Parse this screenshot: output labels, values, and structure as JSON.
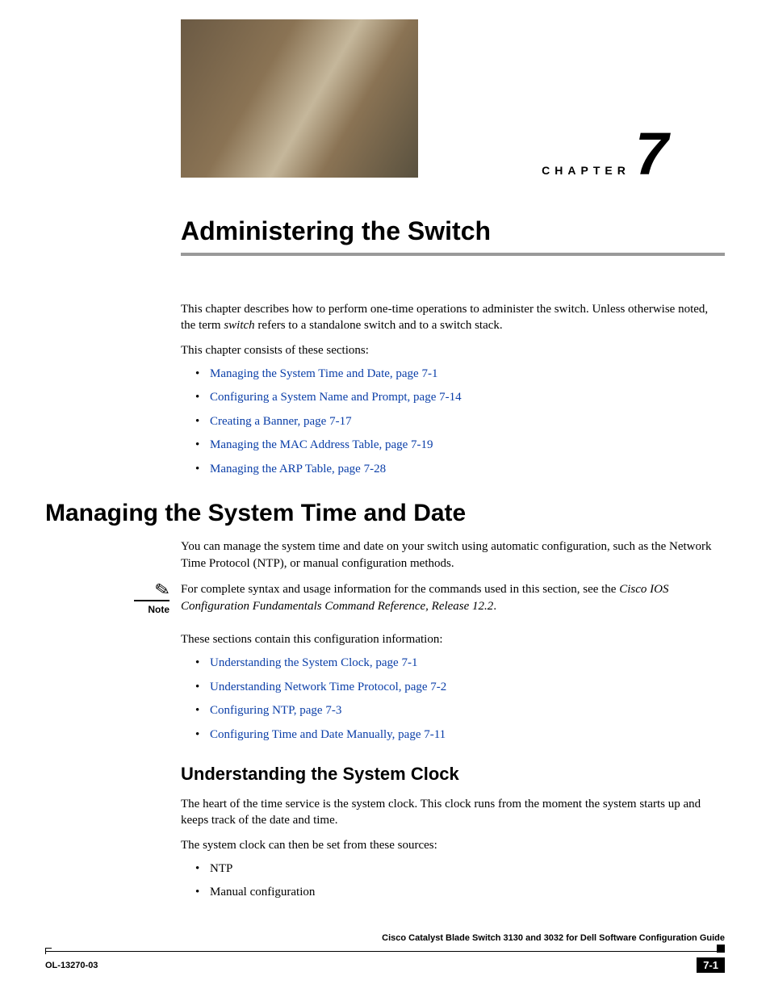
{
  "chapter": {
    "label": "CHAPTER",
    "number": "7",
    "title": "Administering the Switch"
  },
  "intro": {
    "p1_a": "This chapter describes how to perform one-time operations to administer the switch. Unless otherwise noted, the term ",
    "p1_italic": "switch",
    "p1_b": " refers to a standalone switch and to a switch stack.",
    "p2": "This chapter consists of these sections:"
  },
  "sections_list": [
    "Managing the System Time and Date, page 7-1",
    "Configuring a System Name and Prompt, page 7-14",
    "Creating a Banner, page 7-17",
    "Managing the MAC Address Table, page 7-19",
    "Managing the ARP Table, page 7-28"
  ],
  "h1_managing": "Managing the System Time and Date",
  "managing_p1": "You can manage the system time and date on your switch using automatic configuration, such as the Network Time Protocol (NTP), or manual configuration methods.",
  "note": {
    "label": "Note",
    "text_a": "For complete syntax and usage information for the commands used in this section, see the ",
    "text_italic": "Cisco IOS Configuration Fundamentals Command Reference, Release 12.2",
    "text_b": "."
  },
  "managing_p2": "These sections contain this configuration information:",
  "subsections_list": [
    "Understanding the System Clock, page 7-1",
    "Understanding Network Time Protocol, page 7-2",
    "Configuring NTP, page 7-3",
    "Configuring Time and Date Manually, page 7-11"
  ],
  "h2_clock": "Understanding the System Clock",
  "clock_p1": "The heart of the time service is the system clock. This clock runs from the moment the system starts up and keeps track of the date and time.",
  "clock_p2": "The system clock can then be set from these sources:",
  "sources_list": [
    "NTP",
    "Manual configuration"
  ],
  "footer": {
    "guide": "Cisco Catalyst Blade Switch 3130 and 3032 for Dell Software Configuration Guide",
    "docid": "OL-13270-03",
    "page": "7-1"
  }
}
